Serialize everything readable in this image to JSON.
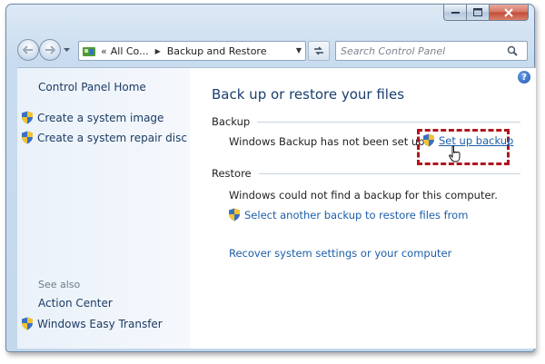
{
  "address": {
    "prefix": "«",
    "crumb1": "All Co...",
    "crumb2": "Backup and Restore"
  },
  "search": {
    "placeholder": "Search Control Panel"
  },
  "left_pane": {
    "home": "Control Panel Home",
    "links": [
      "Create a system image",
      "Create a system repair disc"
    ],
    "see_also_label": "See also",
    "see_also": [
      "Action Center",
      "Windows Easy Transfer"
    ]
  },
  "main": {
    "title": "Back up or restore your files",
    "backup_heading": "Backup",
    "backup_status": "Windows Backup has not been set up.",
    "setup_link": "Set up backup",
    "restore_heading": "Restore",
    "restore_status": "Windows could not find a backup for this computer.",
    "select_backup_link": "Select another backup to restore files from",
    "recover_link": "Recover system settings or your computer"
  },
  "icons": {
    "shield": "uac-shield-icon",
    "help": "help-icon",
    "search": "search-icon",
    "refresh": "refresh-icon"
  },
  "colors": {
    "link": "#1b5ea8",
    "title": "#1a3e6e",
    "highlight": "#b0151d"
  }
}
